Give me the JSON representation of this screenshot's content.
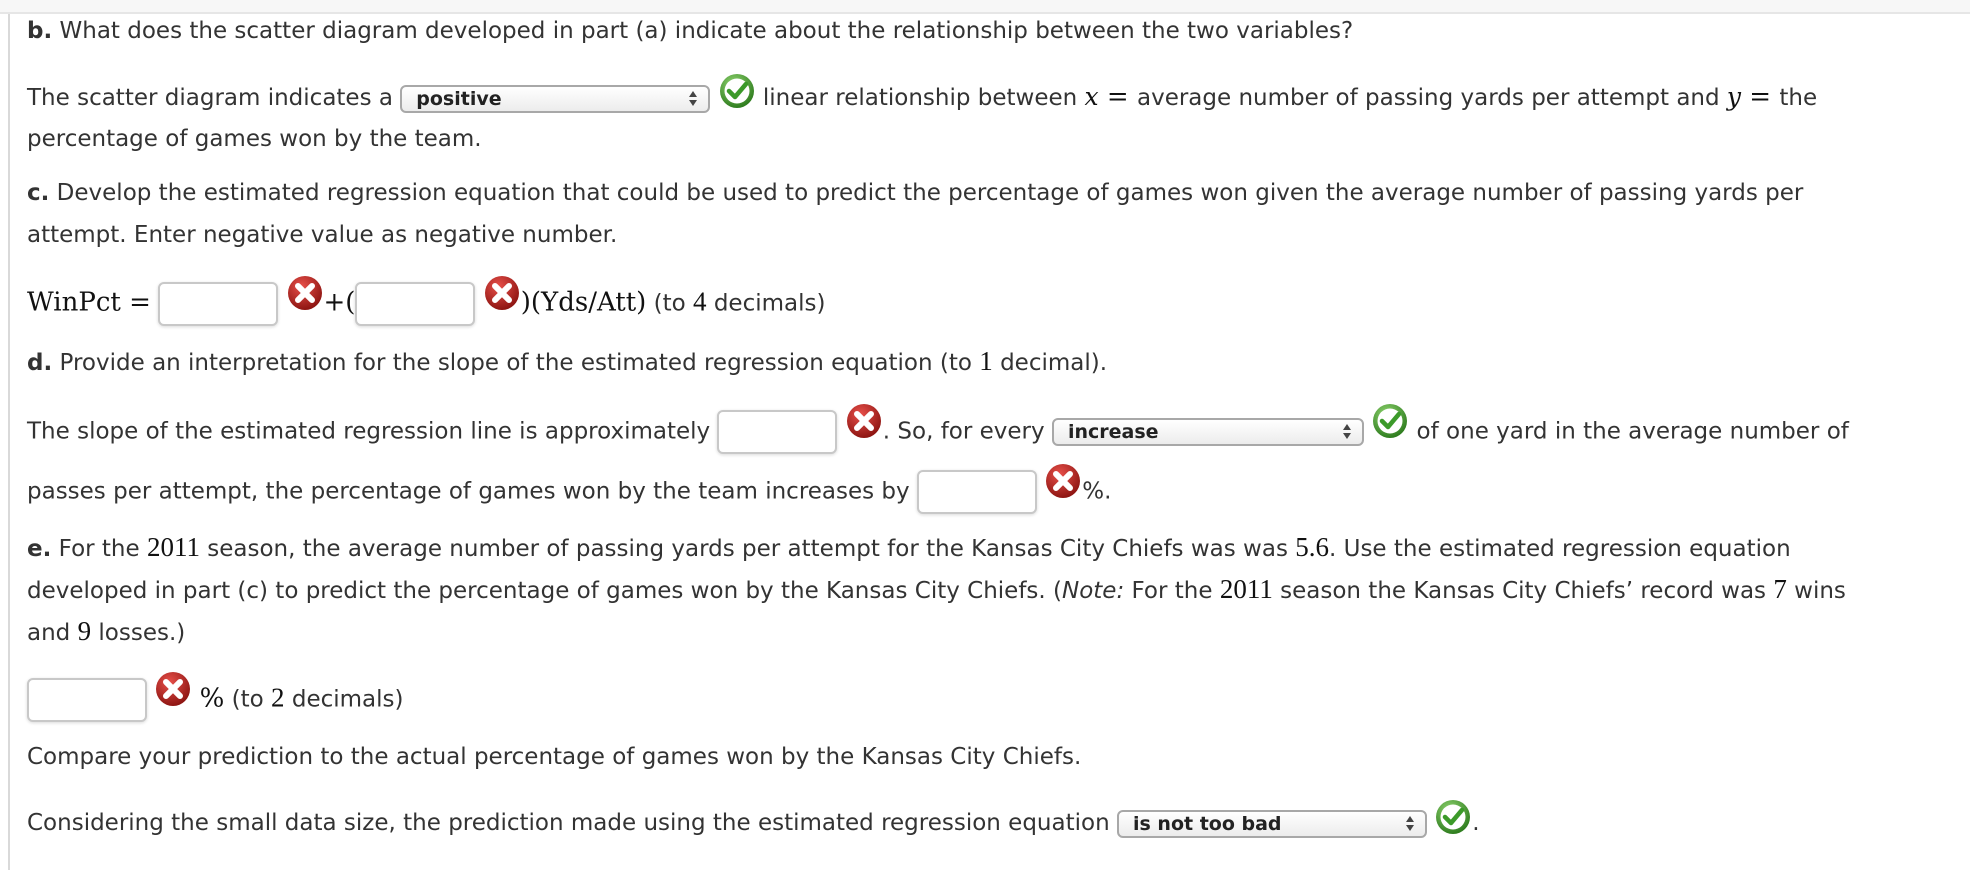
{
  "part_b": {
    "label": "b.",
    "question": " What does the scatter diagram developed in part (a) indicate about the relationship between the two variables?",
    "sentence_pre": "The scatter diagram indicates a ",
    "select_value": "positive",
    "sentence_mid1": " linear relationship between ",
    "var_x": "x",
    "eq1": " = ",
    "x_desc": "average number of passing yards per attempt and ",
    "var_y": "y",
    "eq2": " = ",
    "y_desc": "the",
    "sentence_cont": "percentage of games won by the team.",
    "status": "correct"
  },
  "part_c": {
    "label": "c.",
    "question_line1": " Develop the estimated regression equation that could be used to predict the percentage of games won given the average number of passing yards per",
    "question_line2": "attempt. Enter negative value as negative number.",
    "lhs": "WinPct =",
    "intercept_value": "",
    "plus": "+(",
    "slope_value": "",
    "rhs": ")(Yds/Att)",
    "precision_pre": " (to ",
    "precision_num": "4",
    "precision_post": " decimals)",
    "intercept_status": "incorrect",
    "slope_status": "incorrect"
  },
  "part_d": {
    "label": "d.",
    "question_pre": " Provide an interpretation for the slope of the estimated regression equation (to ",
    "question_num": "1",
    "question_post": " decimal).",
    "sentence_pre": "The slope of the estimated regression line is approximately ",
    "slope_value": "",
    "sentence_mid": ". So, for every ",
    "select_value": "increase",
    "sentence_post": " of one yard in the average number of",
    "line2_pre": "passes per attempt, the percentage of games won by the team increases by ",
    "increase_value": "",
    "line2_post": "%.",
    "slope_status": "incorrect",
    "select_status": "correct",
    "increase_status": "incorrect"
  },
  "part_e": {
    "label": "e.",
    "l1_a": " For the ",
    "year": "2011",
    "l1_b": " season, the average number of passing yards per attempt for the Kansas City Chiefs was was ",
    "ypa": "5.6",
    "l1_c": ". Use the estimated regression equation",
    "l2_a": "developed in part (c) to predict the percentage of games won by the Kansas City Chiefs. (",
    "note": "Note:",
    "l2_b": " For the ",
    "l2_c": " season the Kansas City Chiefs’ record was ",
    "wins": "7",
    "l2_d": " wins",
    "l3_a": "and ",
    "losses": "9",
    "l3_b": " losses.)",
    "prediction_value": "",
    "pct": "%",
    "prec_pre": " (to ",
    "prec_num": "2",
    "prec_post": " decimals)",
    "prediction_status": "incorrect",
    "compare": "Compare your prediction to the actual percentage of games won by the Kansas City Chiefs.",
    "consider_pre": "Considering the small data size, the prediction made using the estimated regression equation ",
    "select_value": "is not too bad",
    "consider_post": ".",
    "select_status": "correct"
  },
  "colors": {
    "correct": "#3c9a2a",
    "incorrect": "#b3221e",
    "text": "#333333"
  }
}
